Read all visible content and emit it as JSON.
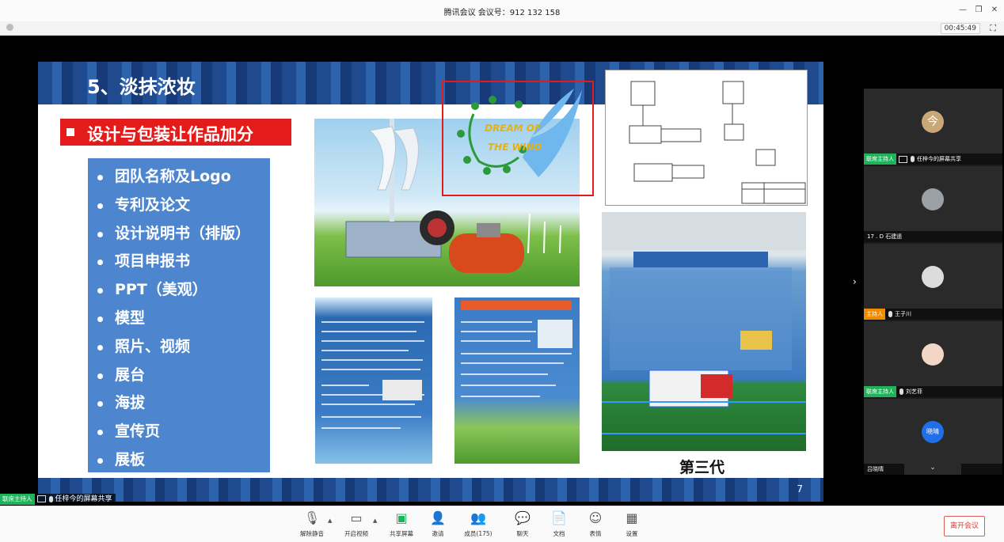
{
  "window": {
    "title": "腾讯会议 会议号：912 132 158",
    "timer": "00:45:49"
  },
  "slide": {
    "header_title": "5、淡抹浓妆",
    "banner": "设计与包装让作品加分",
    "items": [
      "团队名称及Logo",
      "专利及论文",
      "设计说明书（排版）",
      "项目申报书",
      "PPT（美观）",
      "模型",
      "照片、视频",
      "展台",
      "海拔",
      "宣传页",
      "展板"
    ],
    "logo_text_1": "DREAM OF",
    "logo_text_2": "THE WIND",
    "caption": "第三代",
    "page_number": "7"
  },
  "participants": [
    {
      "name": "任梓今的屏幕共享",
      "role": "联席主持人",
      "avatar_glyph": "今",
      "avatar_color": "#c9a877"
    },
    {
      "name": "17 . D 石建遥",
      "role": "",
      "avatar_glyph": "",
      "avatar_color": "#9aa0a6"
    },
    {
      "name": "王子川",
      "role": "主持人",
      "avatar_glyph": "",
      "avatar_color": "#dcdcdc"
    },
    {
      "name": "刘艺菲",
      "role": "联席主持人",
      "avatar_glyph": "",
      "avatar_color": "#f2d7c7"
    },
    {
      "name": "吕晓晴",
      "role": "",
      "avatar_glyph": "晓晴",
      "avatar_color": "#1e6fe8"
    }
  ],
  "presenter_bar": {
    "role": "联席主持人",
    "name": "任梓今的屏幕共享"
  },
  "toolbar": {
    "items": [
      {
        "label": "解除静音",
        "icon": "mic-muted-icon"
      },
      {
        "label": "开启视频",
        "icon": "camera-off-icon"
      },
      {
        "label": "共享屏幕",
        "icon": "share-screen-icon"
      },
      {
        "label": "邀请",
        "icon": "invite-icon"
      },
      {
        "label": "成员(175)",
        "icon": "members-icon"
      },
      {
        "label": "聊天",
        "icon": "chat-icon"
      },
      {
        "label": "文档",
        "icon": "document-icon"
      },
      {
        "label": "表情",
        "icon": "emoji-icon"
      },
      {
        "label": "设置",
        "icon": "settings-icon"
      }
    ],
    "leave": "离开会议"
  },
  "colors": {
    "accent_green": "#1fb35a",
    "host_orange": "#f08a00",
    "leave_red": "#d93d3d",
    "slide_blue": "#1f4a8e",
    "banner_red": "#e31b1b"
  }
}
